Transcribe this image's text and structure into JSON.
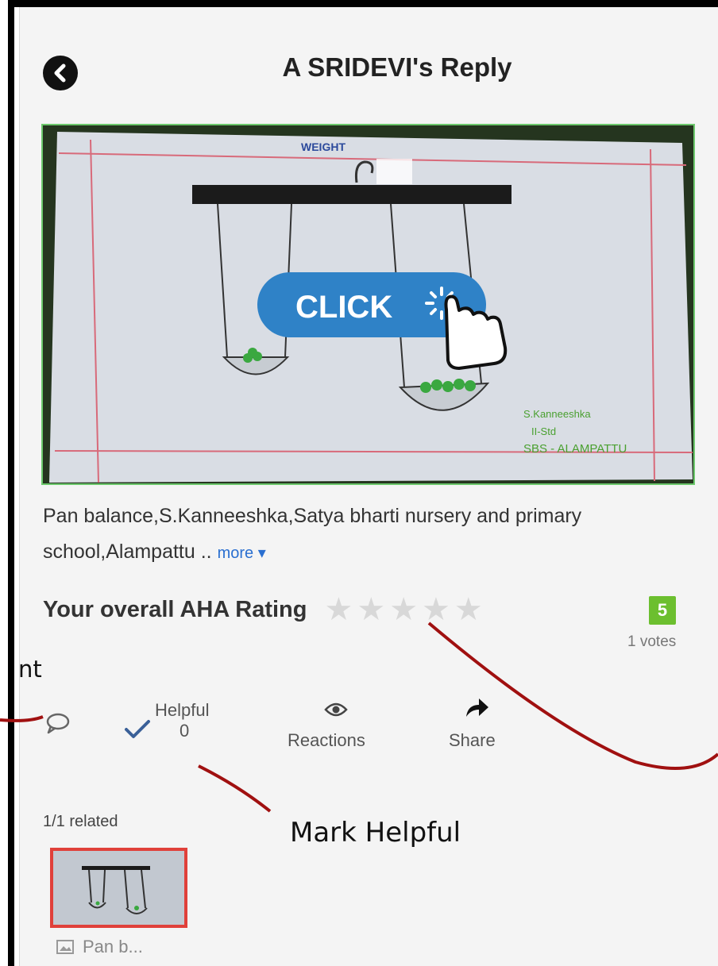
{
  "header": {
    "title": "A SRIDEVI's Reply",
    "back_icon": "chevron-left-icon"
  },
  "media": {
    "click_label": "CLICK",
    "drawing_title": "WEIGHT",
    "signature_lines": [
      "S.Kanneeshka",
      "II-Std",
      "SBS - ALAMPATTU"
    ]
  },
  "post": {
    "description": "Pan balance,S.Kanneeshka,Satya bharti nursery and primary school,Alampattu ..",
    "more_label": "more ▾"
  },
  "rating": {
    "label": "Your overall AHA Rating",
    "stars_total": 5,
    "stars_filled": 0,
    "score": "5",
    "votes_label": "1 votes",
    "badge_color": "#6cbf2f"
  },
  "actions": {
    "helpful_label": "Helpful",
    "helpful_count": "0",
    "reactions_label": "Reactions",
    "share_label": "Share"
  },
  "related": {
    "label": "1/1 related",
    "thumb_caption": "Pan b..."
  },
  "annotations": {
    "comment_text": "nt",
    "helpful_text": "Mark Helpful",
    "line_color": "#a01010"
  }
}
